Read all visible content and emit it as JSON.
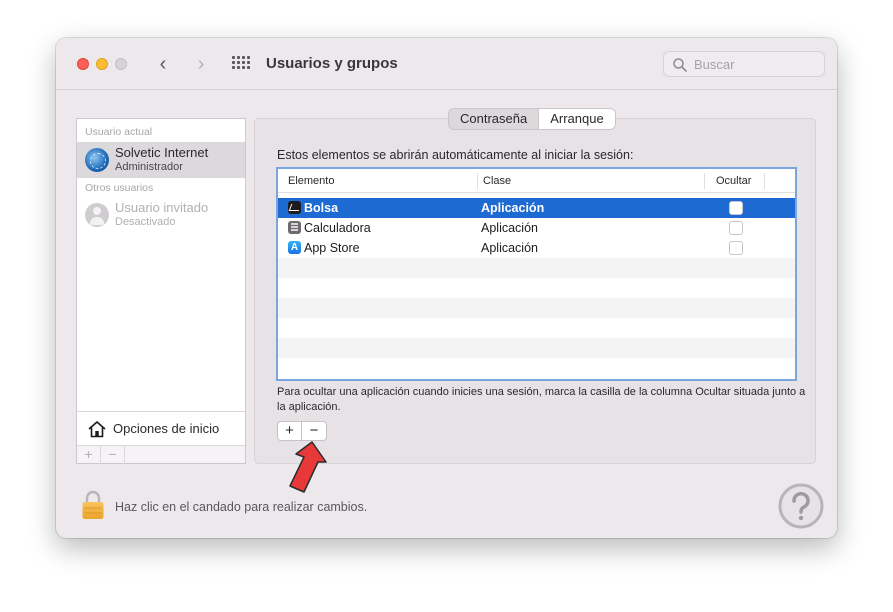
{
  "window": {
    "title": "Usuarios y grupos",
    "search_placeholder": "Buscar"
  },
  "sidebar": {
    "current_user_label": "Usuario actual",
    "current_user": {
      "name": "Solvetic Internet",
      "role": "Administrador"
    },
    "other_users_label": "Otros usuarios",
    "other_users": [
      {
        "name": "Usuario invitado",
        "role": "Desactivado"
      }
    ],
    "login_options_label": "Opciones de inicio",
    "add_symbol": "+",
    "remove_symbol": "−"
  },
  "tabs": [
    {
      "label": "Contraseña",
      "active": false
    },
    {
      "label": "Arranque",
      "active": true
    }
  ],
  "main": {
    "description": "Estos elementos se abrirán automáticamente al iniciar la sesión:",
    "columns": {
      "item": "Elemento",
      "class": "Clase",
      "hide": "Ocultar"
    },
    "rows": [
      {
        "name": "Bolsa",
        "class": "Aplicación",
        "icon": "stocks-icon",
        "selected": true,
        "hidden": false
      },
      {
        "name": "Calculadora",
        "class": "Aplicación",
        "icon": "calculator-icon",
        "selected": false,
        "hidden": false
      },
      {
        "name": "App Store",
        "class": "Aplicación",
        "icon": "app-store-icon",
        "selected": false,
        "hidden": false
      }
    ],
    "hint": "Para ocultar una aplicación cuando inicies una sesión, marca la casilla de la columna Ocultar situada junto a la aplicación.",
    "add_symbol": "+",
    "remove_symbol": "−"
  },
  "footer": {
    "lock_text": "Haz clic en el candado para realizar cambios."
  },
  "colors": {
    "selection": "#1d6ad3",
    "table_focus_ring": "#7ba5de",
    "annotation_arrow": "#e8393a"
  }
}
